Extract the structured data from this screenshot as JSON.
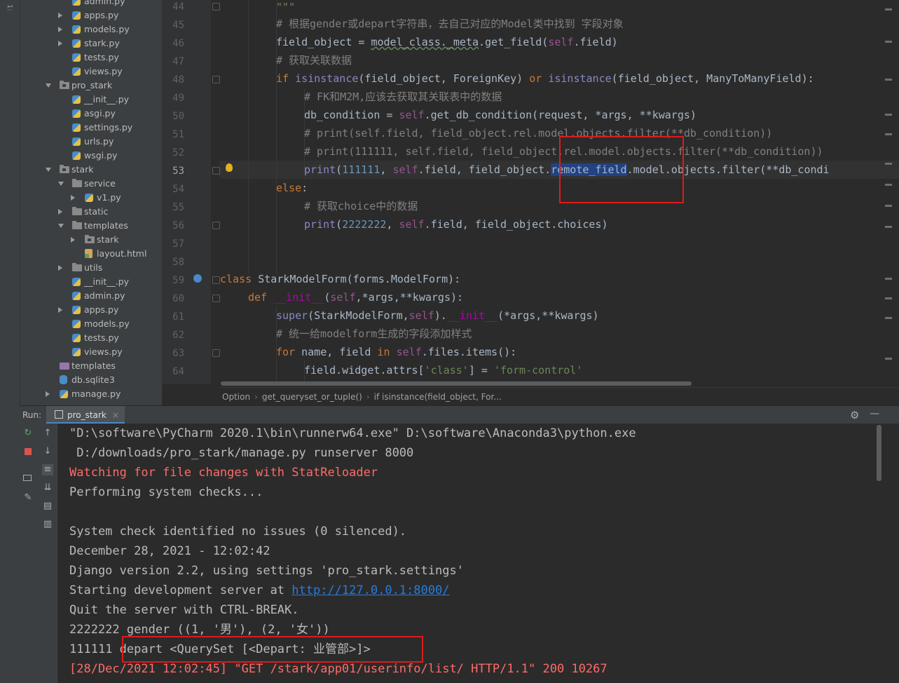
{
  "sidebar": {
    "rows": [
      {
        "label": "admin.py",
        "type": "py",
        "arrow": "none",
        "depth": 1
      },
      {
        "label": "apps.py",
        "type": "py",
        "arrow": "right",
        "depth": 1
      },
      {
        "label": "models.py",
        "type": "py",
        "arrow": "right",
        "depth": 1
      },
      {
        "label": "stark.py",
        "type": "py",
        "arrow": "right",
        "depth": 1
      },
      {
        "label": "tests.py",
        "type": "py",
        "arrow": "none",
        "depth": 1
      },
      {
        "label": "views.py",
        "type": "py",
        "arrow": "none",
        "depth": 1
      },
      {
        "label": "pro_stark",
        "type": "folder",
        "arrow": "down",
        "depth": 0
      },
      {
        "label": "__init__.py",
        "type": "py",
        "arrow": "none",
        "depth": 1
      },
      {
        "label": "asgi.py",
        "type": "py",
        "arrow": "none",
        "depth": 1
      },
      {
        "label": "settings.py",
        "type": "py",
        "arrow": "none",
        "depth": 1
      },
      {
        "label": "urls.py",
        "type": "py",
        "arrow": "none",
        "depth": 1
      },
      {
        "label": "wsgi.py",
        "type": "py",
        "arrow": "none",
        "depth": 1
      },
      {
        "label": "stark",
        "type": "folder",
        "arrow": "down",
        "depth": 0
      },
      {
        "label": "service",
        "type": "folder",
        "arrow": "down",
        "depth": 1
      },
      {
        "label": "v1.py",
        "type": "py",
        "arrow": "right",
        "depth": 2
      },
      {
        "label": "static",
        "type": "folder",
        "arrow": "right",
        "depth": 1
      },
      {
        "label": "templates",
        "type": "folder",
        "arrow": "down",
        "depth": 1
      },
      {
        "label": "stark",
        "type": "folder",
        "arrow": "right",
        "depth": 2
      },
      {
        "label": "layout.html",
        "type": "html",
        "arrow": "none",
        "depth": 2
      },
      {
        "label": "utils",
        "type": "folder",
        "arrow": "right",
        "depth": 1
      },
      {
        "label": "__init__.py",
        "type": "py",
        "arrow": "none",
        "depth": 1
      },
      {
        "label": "admin.py",
        "type": "py",
        "arrow": "none",
        "depth": 1
      },
      {
        "label": "apps.py",
        "type": "py",
        "arrow": "right",
        "depth": 1
      },
      {
        "label": "models.py",
        "type": "py",
        "arrow": "none",
        "depth": 1
      },
      {
        "label": "tests.py",
        "type": "py",
        "arrow": "none",
        "depth": 1
      },
      {
        "label": "views.py",
        "type": "py",
        "arrow": "none",
        "depth": 1
      },
      {
        "label": "templates",
        "type": "tpl",
        "arrow": "none",
        "depth": 0
      },
      {
        "label": "db.sqlite3",
        "type": "db",
        "arrow": "none",
        "depth": 0
      },
      {
        "label": "manage.py",
        "type": "py",
        "arrow": "right",
        "depth": 0
      }
    ]
  },
  "editor": {
    "line_numbers": [
      "44",
      "45",
      "46",
      "47",
      "48",
      "49",
      "50",
      "51",
      "52",
      "53",
      "54",
      "55",
      "56",
      "57",
      "58",
      "59",
      "60",
      "61",
      "62",
      "63",
      "64"
    ],
    "current_line": "53",
    "lines": {
      "l44": "\"\"\"",
      "l45": "# 根据gender或depart字符串，去自己对应的Model类中找到 字段对象",
      "l46a": "field_object = ",
      "l46b": "model_class._meta",
      "l46c": ".get_field(",
      "l46d": "self",
      "l46e": ".field)",
      "l47": "# 获取关联数据",
      "l48a": "if ",
      "l48b": "isinstance",
      "l48c": "(field_object, ForeignKey) ",
      "l48d": "or ",
      "l48e": "isinstance",
      "l48f": "(field_object, ManyToManyField):",
      "l49": "# FK和M2M,应该去获取其关联表中的数据",
      "l50a": "db_condition = ",
      "l50b": "self",
      "l50c": ".get_db_condition(request, *args, **kwargs)",
      "l51": "# print(self.field, field_object.rel.model.objects.filter(**db_condition))",
      "l52": "# print(111111, self.field, field_object.rel.model.objects.filter(**db_condition))",
      "l53a": "print",
      "l53b": "(",
      "l53c": "111111",
      "l53d": ", ",
      "l53e": "self",
      "l53f": ".field, field_object.",
      "l53g": "remote_field",
      "l53h": ".model.objects.filter(**db_condi",
      "l54a": "else",
      "l54b": ":",
      "l55": "# 获取choice中的数据",
      "l56a": "print",
      "l56b": "(",
      "l56c": "2222222",
      "l56d": ", ",
      "l56e": "self",
      "l56f": ".field, field_object.choices)",
      "l59a": "class ",
      "l59b": "StarkModelForm(forms.ModelForm):",
      "l60a": "def ",
      "l60b": "__init__",
      "l60c": "(",
      "l60d": "self",
      "l60e": ",*args,**kwargs):",
      "l61a": "super",
      "l61b": "(StarkModelForm,",
      "l61c": "self",
      "l61d": ").",
      "l61e": "__init__",
      "l61f": "(*args,**kwargs)",
      "l62": "# 统一给modelform生成的字段添加样式",
      "l63a": "for ",
      "l63b": "name, field ",
      "l63c": "in ",
      "l63d": "self",
      "l63e": ".files.items():",
      "l64a": "field.widget.attrs[",
      "l64b": "'class'",
      "l64c": "] = ",
      "l64d": "'form-control'"
    },
    "breadcrumbs": [
      "Option",
      "get_queryset_or_tuple()",
      "if isinstance(field_object, For..."
    ]
  },
  "run": {
    "label": "Run:",
    "tab": "pro_stark",
    "tab_close": "×",
    "gear": "⚙",
    "minimize": "—"
  },
  "console": {
    "lines": [
      "\"D:\\software\\PyCharm 2020.1\\bin\\runnerw64.exe\" D:\\software\\Anaconda3\\python.exe",
      " D:/downloads/pro_stark/manage.py runserver 8000",
      "Watching for file changes with StatReloader",
      "Performing system checks...",
      "",
      "System check identified no issues (0 silenced).",
      "December 28, 2021 - 12:02:42",
      "Django version 2.2, using settings 'pro_stark.settings'",
      "Starting development server at ",
      "Quit the server with CTRL-BREAK.",
      "2222222 gender ((1, '男'), (2, '女'))",
      "111111 depart <QuerySet [<Depart: 业管部>]>",
      "[28/Dec/2021 12:02:45] \"GET /stark/app01/userinfo/list/ HTTP/1.1\" 200 10267"
    ],
    "link": "http://127.0.0.1:8000/"
  },
  "colors": {
    "highlight_box": "#e01a1a",
    "error_text": "#ff6b68",
    "link": "#287bde"
  }
}
